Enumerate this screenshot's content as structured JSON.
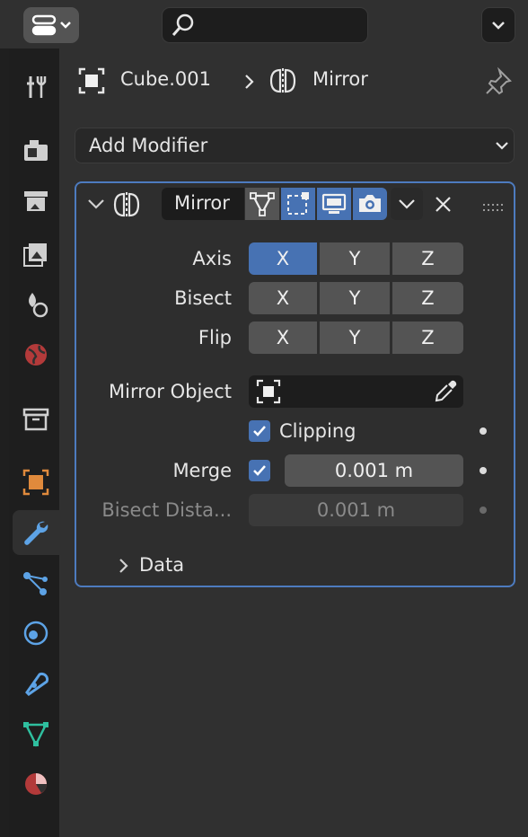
{
  "header": {
    "object_name": "Cube.001",
    "modifier_name": "Mirror"
  },
  "add_modifier": {
    "label": "Add Modifier"
  },
  "modifier": {
    "name": "Mirror",
    "axis": {
      "label": "Axis",
      "x": "X",
      "y": "Y",
      "z": "Z",
      "active": "X"
    },
    "bisect": {
      "label": "Bisect",
      "x": "X",
      "y": "Y",
      "z": "Z"
    },
    "flip": {
      "label": "Flip",
      "x": "X",
      "y": "Y",
      "z": "Z"
    },
    "mirror_object": {
      "label": "Mirror Object",
      "value": ""
    },
    "clipping": {
      "label": "Clipping",
      "checked": true
    },
    "merge": {
      "label": "Merge",
      "checked": true,
      "value": "0.001 m"
    },
    "bisect_distance": {
      "label": "Bisect Dista...",
      "value": "0.001 m"
    },
    "data_section": {
      "label": "Data"
    }
  },
  "colors": {
    "accent": "#4772b3",
    "panel_border": "#4d7bbf"
  },
  "sidebar_tabs": [
    "tool-icon",
    "render-icon",
    "output-icon",
    "view-layer-icon",
    "scene-icon",
    "world-icon",
    "collection-icon",
    "object-icon",
    "modifier-icon",
    "particles-icon",
    "physics-icon",
    "constraints-icon",
    "object-data-icon",
    "material-icon"
  ]
}
